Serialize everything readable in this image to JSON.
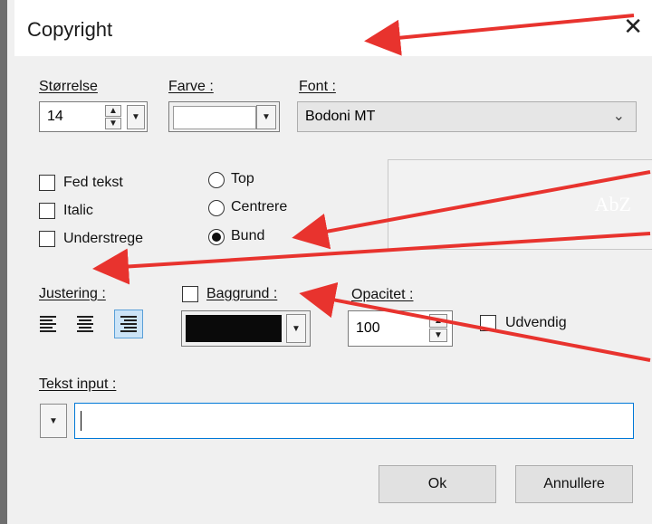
{
  "window": {
    "title": "Copyright",
    "close_glyph": "✕"
  },
  "size": {
    "label": "Størrelse",
    "value": "14"
  },
  "color": {
    "label": "Farve :",
    "value_color": "#ffffff"
  },
  "font": {
    "label": "Font :",
    "value": "Bodoni MT"
  },
  "styles": {
    "bold_label": "Fed tekst",
    "bold_checked": false,
    "italic_label": "Italic",
    "italic_checked": false,
    "underline_label": "Understrege",
    "underline_checked": false
  },
  "position": {
    "top_label": "Top",
    "center_label": "Centrere",
    "bottom_label": "Bund",
    "selected": "Bund"
  },
  "preview": {
    "text": "AbZ"
  },
  "alignment": {
    "label": "Justering :",
    "selected": "right"
  },
  "background": {
    "label": "Baggrund :",
    "checked": false,
    "color": "#0a0a0a"
  },
  "opacity": {
    "label": "Opacitet :",
    "value": "100"
  },
  "outside": {
    "label": "Udvendig",
    "checked": false
  },
  "text_input": {
    "label": "Tekst input :",
    "value": ""
  },
  "buttons": {
    "ok": "Ok",
    "cancel": "Annullere"
  },
  "annotation_color": "#e8332e"
}
